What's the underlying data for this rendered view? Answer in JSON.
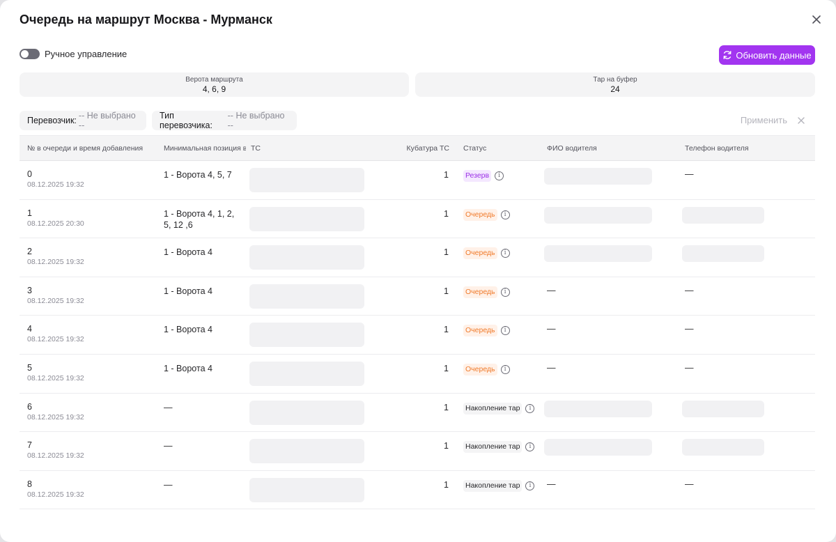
{
  "title": "Очередь на маршрут Москва - Мурманск",
  "manual_label": "Ручное управление",
  "refresh_label": "Обновить данные",
  "info": {
    "gates_label": "Верота маршрута",
    "gates_value": "4, 6, 9",
    "buffer_label": "Тар на буфер",
    "buffer_value": "24"
  },
  "filters": {
    "carrier_label": "Перевозчик:",
    "carrier_value": "-- Не выбрано --",
    "carrier_type_label": "Тип перевозчика:",
    "carrier_type_value": "-- Не выбрано --",
    "apply_label": "Применить"
  },
  "columns": [
    "№ в очереди и время добавления",
    "Минимальная позиция в",
    "ТС",
    "Кубатура ТС",
    "Статус",
    "ФИО водителя",
    "Телефон водителя"
  ],
  "dash": "—",
  "rows": [
    {
      "num": "0",
      "date": "08.12.2025 19:32",
      "min_pos": [
        "1 - Ворота 4, 5, 7"
      ],
      "cube": "1",
      "status": "Резерв",
      "status_kind": "reserve",
      "driver": "ph",
      "phone": "dash"
    },
    {
      "num": "1",
      "date": "08.12.2025 20:30",
      "min_pos": [
        "1 - Ворота 4, 1, 2,",
        "5, 12 ,6"
      ],
      "cube": "1",
      "status": "Очередь",
      "status_kind": "queue",
      "driver": "ph",
      "phone": "ph"
    },
    {
      "num": "2",
      "date": "08.12.2025 19:32",
      "min_pos": [
        "1 - Ворота 4"
      ],
      "cube": "1",
      "status": "Очередь",
      "status_kind": "queue",
      "driver": "ph",
      "phone": "ph"
    },
    {
      "num": "3",
      "date": "08.12.2025 19:32",
      "min_pos": [
        "1 - Ворота 4"
      ],
      "cube": "1",
      "status": "Очередь",
      "status_kind": "queue",
      "driver": "dash",
      "phone": "dash"
    },
    {
      "num": "4",
      "date": "08.12.2025 19:32",
      "min_pos": [
        "1 - Ворота 4"
      ],
      "cube": "1",
      "status": "Очередь",
      "status_kind": "queue",
      "driver": "dash",
      "phone": "dash"
    },
    {
      "num": "5",
      "date": "08.12.2025 19:32",
      "min_pos": [
        "1 - Ворота 4"
      ],
      "cube": "1",
      "status": "Очередь",
      "status_kind": "queue",
      "driver": "dash",
      "phone": "dash"
    },
    {
      "num": "6",
      "date": "08.12.2025 19:32",
      "min_pos": [],
      "cube": "1",
      "status": "Накопление тар",
      "status_kind": "accum",
      "driver": "ph",
      "phone": "ph"
    },
    {
      "num": "7",
      "date": "08.12.2025 19:32",
      "min_pos": [],
      "cube": "1",
      "status": "Накопление тар",
      "status_kind": "accum",
      "driver": "ph",
      "phone": "ph"
    },
    {
      "num": "8",
      "date": "08.12.2025 19:32",
      "min_pos": [],
      "cube": "1",
      "status": "Накопление тар",
      "status_kind": "accum",
      "driver": "dash",
      "phone": "dash"
    }
  ],
  "colors": {
    "accent": "#a235f0",
    "reserve": "#9b30e6",
    "queue": "#f07a2a"
  },
  "icons": {
    "close": "close-icon",
    "refresh": "refresh-icon",
    "info": "info-icon",
    "reset": "close-icon"
  }
}
